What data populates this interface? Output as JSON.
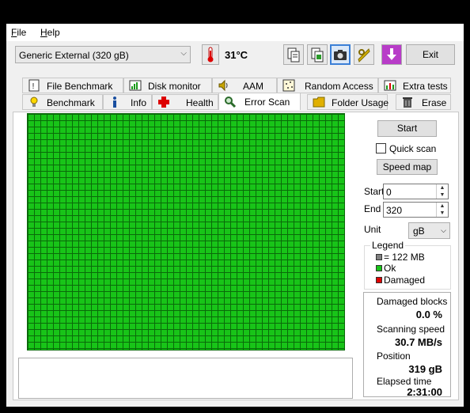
{
  "menu": {
    "file": "File",
    "help": "Help"
  },
  "toolbar": {
    "drive": "Generic External (320 gB)",
    "temperature": "31°C",
    "exit_label": "Exit"
  },
  "tabs_top": [
    {
      "label": "File Benchmark",
      "icon": "file-benchmark-icon"
    },
    {
      "label": "Disk monitor",
      "icon": "disk-monitor-icon"
    },
    {
      "label": "AAM",
      "icon": "speaker-icon"
    },
    {
      "label": "Random Access",
      "icon": "random-access-icon"
    },
    {
      "label": "Extra tests",
      "icon": "extra-tests-icon"
    }
  ],
  "tabs_bottom": [
    {
      "label": "Benchmark",
      "icon": "benchmark-icon"
    },
    {
      "label": "Info",
      "icon": "info-icon"
    },
    {
      "label": "Health",
      "icon": "health-icon"
    },
    {
      "label": "Error Scan",
      "icon": "magnifier-icon",
      "selected": true
    },
    {
      "label": "Folder Usage",
      "icon": "folder-icon"
    },
    {
      "label": "Erase",
      "icon": "trash-icon"
    }
  ],
  "scan": {
    "start_button": "Start",
    "quick_scan_label": "Quick scan",
    "quick_scan_checked": false,
    "speed_map_button": "Speed map",
    "start_label": "Start",
    "start_value": "0",
    "end_label": "End",
    "end_value": "320",
    "unit_label": "Unit",
    "unit_value": "gB"
  },
  "legend": {
    "title": "Legend",
    "block_size": "= 122 MB",
    "ok": "Ok",
    "damaged": "Damaged",
    "colors": {
      "block": "#808080",
      "ok": "#18c418",
      "damaged": "#e00000"
    }
  },
  "stats": {
    "damaged_blocks_label": "Damaged blocks",
    "damaged_blocks_value": "0.0 %",
    "scanning_speed_label": "Scanning speed",
    "scanning_speed_value": "30.7 MB/s",
    "position_label": "Position",
    "position_value": "319 gB",
    "elapsed_label": "Elapsed time",
    "elapsed_value": "2:31:00"
  }
}
